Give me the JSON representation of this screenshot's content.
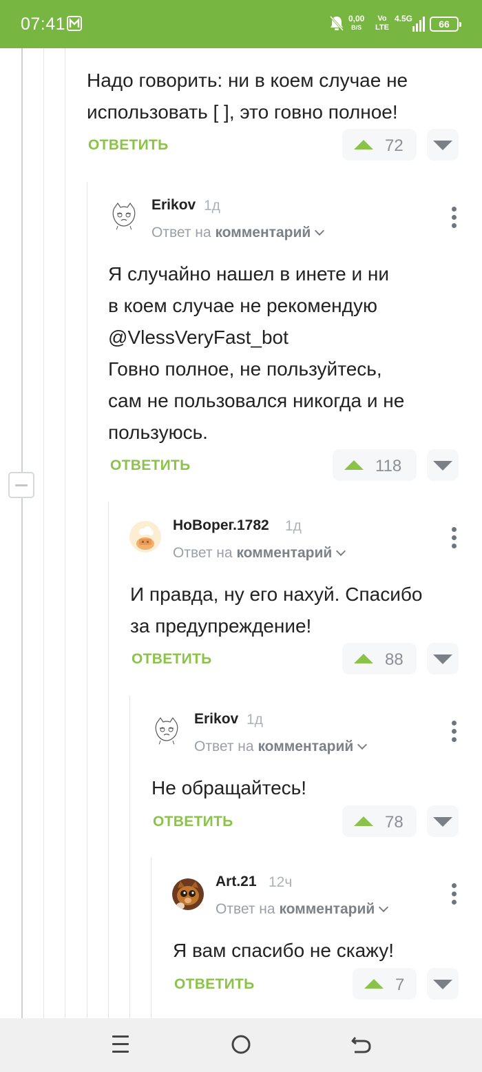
{
  "status_bar": {
    "time": "07:41",
    "net_speed": "0,00",
    "net_unit": "B/S",
    "volte_top": "Vo",
    "volte_bottom": "LTE",
    "network": "4.5G",
    "battery": "66"
  },
  "labels": {
    "reply": "ОТВЕТИТЬ",
    "reply_to_prefix": "Ответ на",
    "reply_to_target": "комментарий"
  },
  "comments": [
    {
      "lines": [
        "Надо говорить: ни в коем случае не",
        "использовать [ ], это говно полное!"
      ],
      "rating": "72"
    },
    {
      "author": "Erikov",
      "time": "1д",
      "lines": [
        "Я случайно нашел в инете и ни",
        "в коем случае не рекомендую",
        "@VlessVeryFast_bot",
        "Говно полное, не пользуйтесь,",
        "сам не пользовался никогда и не",
        "пользуюсь."
      ],
      "rating": "118"
    },
    {
      "author": "НоВорег.1782",
      "time": "1д",
      "lines": [
        "И правда, ну его нахуй. Спасибо",
        "за предупреждение!"
      ],
      "rating": "88"
    },
    {
      "author": "Erikov",
      "time": "1д",
      "lines": [
        "Не обращайтесь!"
      ],
      "rating": "78"
    },
    {
      "author": "Art.21",
      "time": "12ч",
      "lines": [
        "Я вам спасибо не скажу!"
      ],
      "rating": "7"
    }
  ],
  "colors": {
    "status_bar": "#78b642",
    "accent_green": "#8bc34a",
    "text": "#222222",
    "muted": "#9aa0a6"
  },
  "icons": [
    "app-badge-icon",
    "mute-bell-icon",
    "signal-icon",
    "battery-icon",
    "upvote-icon",
    "downvote-icon",
    "more-options-icon",
    "collapse-thread-icon",
    "menu-icon",
    "home-icon",
    "back-icon"
  ]
}
